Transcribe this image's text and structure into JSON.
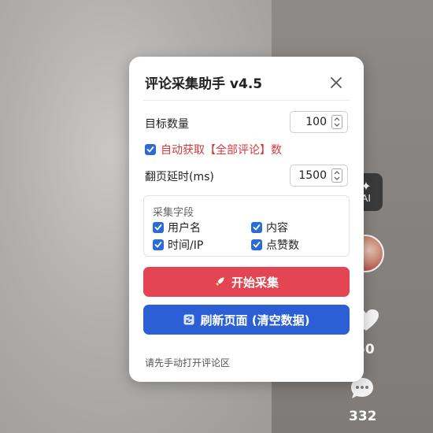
{
  "dialog": {
    "title": "评论采集助手 v4.5",
    "target_count_label": "目标数量",
    "target_count_value": "100",
    "auto_fetch_label": "自动获取【全部评论】数",
    "auto_fetch_checked": true,
    "page_delay_label": "翻页延时(ms)",
    "page_delay_value": "1500",
    "fields_title": "采集字段",
    "fields": [
      {
        "label": "用户名",
        "checked": true
      },
      {
        "label": "内容",
        "checked": true
      },
      {
        "label": "时间/IP",
        "checked": true
      },
      {
        "label": "点赞数",
        "checked": true
      }
    ],
    "start_button_label": "开始采集",
    "refresh_button_label": "刷新页面 (清空数据)",
    "hint_text": "请先手动打开评论区",
    "colors": {
      "start_button": "#e34652",
      "refresh_button": "#2c5fd6",
      "checkbox": "#2c6bd6",
      "auto_fetch_text": "#d8383e"
    }
  },
  "video_rail": {
    "ai_label": "AI",
    "like_count": "50",
    "comment_count": "332"
  }
}
